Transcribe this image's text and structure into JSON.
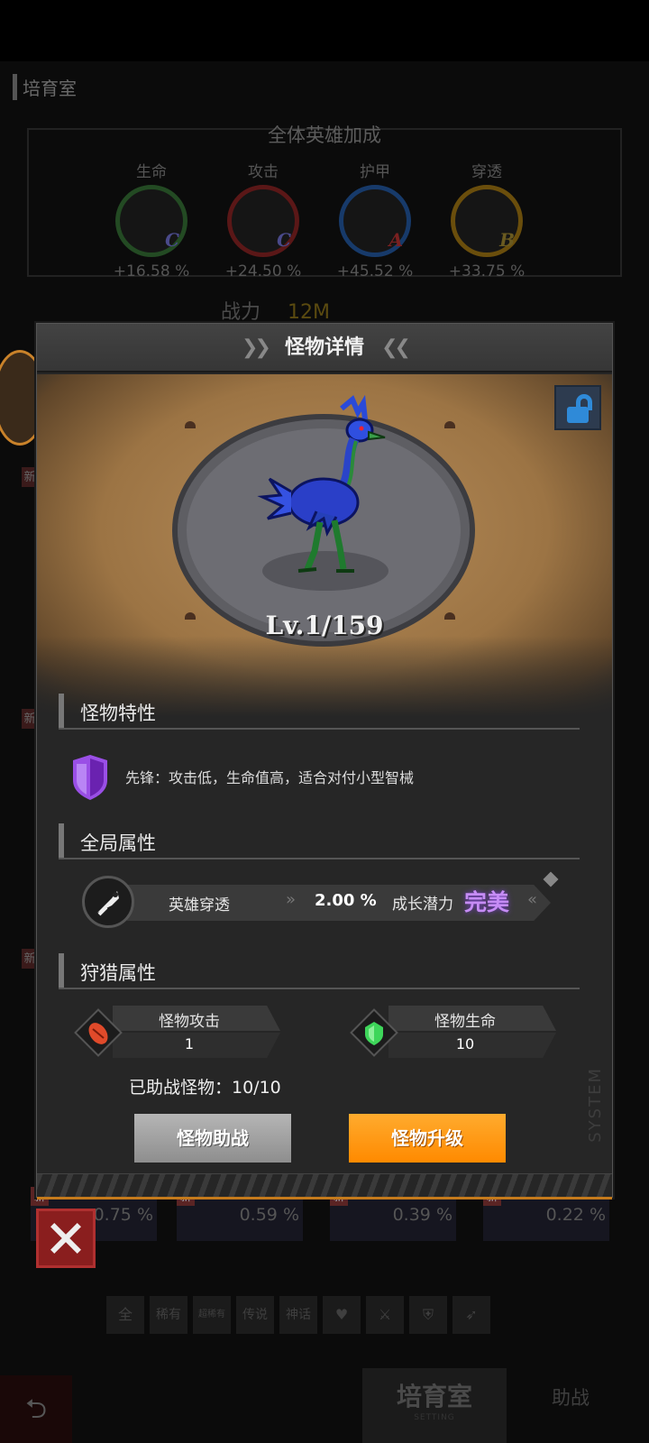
{
  "background": {
    "screen_title": "培育室",
    "bonus_title": "全体英雄加成",
    "stats": [
      {
        "label": "生命",
        "icon": "heart-icon",
        "grade": "C",
        "value": "+16.58 %",
        "color": "#2f6f2f"
      },
      {
        "label": "攻击",
        "icon": "sword-icon",
        "grade": "C",
        "value": "+24.50 %",
        "color": "#7a1f1f"
      },
      {
        "label": "护甲",
        "icon": "shield-icon",
        "grade": "A",
        "value": "+45.52 %",
        "color": "#1f4f8f"
      },
      {
        "label": "穿透",
        "icon": "pierce-icon",
        "grade": "B",
        "value": "+33.75 %",
        "color": "#8f6a10"
      }
    ],
    "power_label": "战力",
    "power_value": "12M",
    "side_badges": [
      "新",
      "新",
      "新",
      "新"
    ],
    "mini_cards": [
      {
        "badge": "新",
        "value": "0.75 %"
      },
      {
        "badge": "新",
        "value": "0.59 %"
      },
      {
        "badge": "新",
        "value": "0.39 %"
      },
      {
        "badge": "新",
        "value": "0.22 %"
      }
    ],
    "filters": [
      "全",
      "稀有",
      "超稀有",
      "传说",
      "神话",
      "♥",
      "⚔",
      "⛨",
      "➶"
    ],
    "nav": {
      "back_icon": "back-arrow-icon",
      "main_label": "培育室",
      "main_sub": "SETTING",
      "help_label": "助战"
    }
  },
  "modal": {
    "title": "怪物详情",
    "level": "Lv.1/159",
    "trait_section": "怪物特性",
    "trait_text": "先锋：攻击低，生命值高，适合对付小型智械",
    "global_section": "全局属性",
    "global_attr": {
      "name": "英雄穿透",
      "value": "2.00 %",
      "growth_label": "成长潜力",
      "grade": "完美"
    },
    "hunt_section": "狩猎属性",
    "hunt_attack": {
      "label": "怪物攻击",
      "value": "1"
    },
    "hunt_hp": {
      "label": "怪物生命",
      "value": "10"
    },
    "assisted": "已助战怪物：10/10",
    "btn_assist": "怪物助战",
    "btn_upgrade": "怪物升级",
    "side_mark": "SYSTEM",
    "accent": "#ff8a00"
  }
}
